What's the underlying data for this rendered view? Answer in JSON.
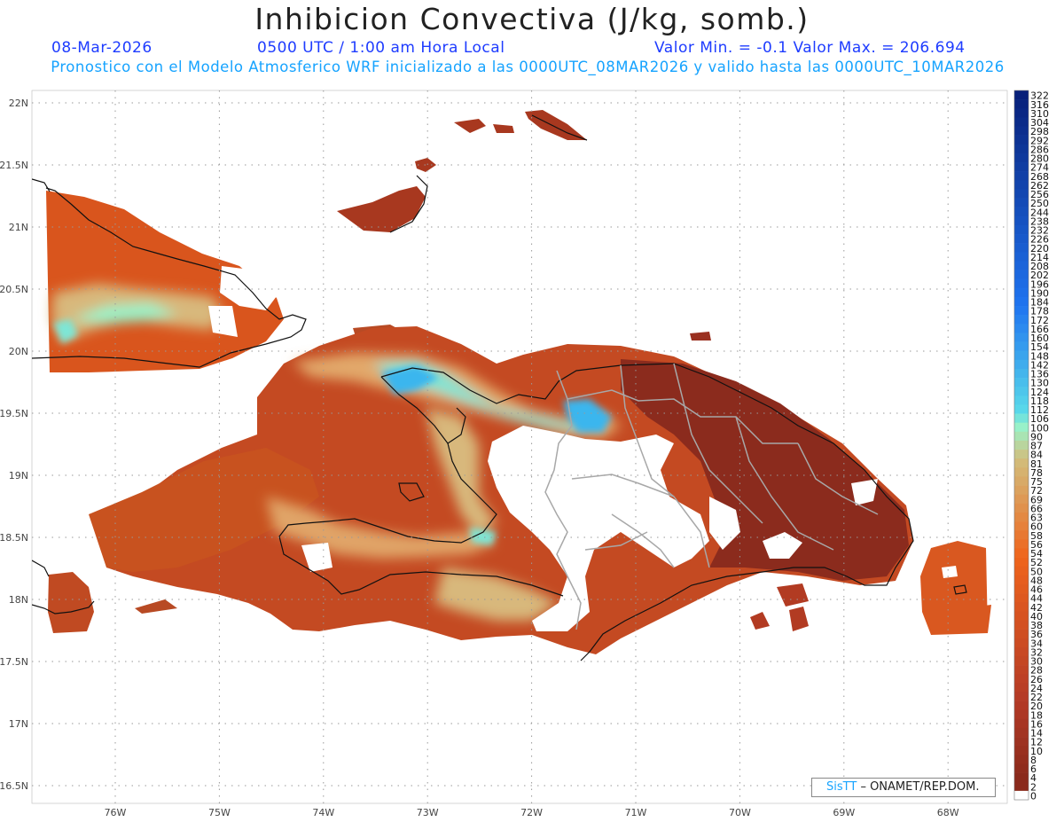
{
  "header": {
    "title": "Inhibicion Convectiva (J/kg, somb.)",
    "date": "08-Mar-2026",
    "utc_local": "0500 UTC / 1:00 am Hora Local",
    "min_max": "Valor Min. = -0.1  Valor Max. = 206.694",
    "model_line": "Pronostico con el Modelo Atmosferico WRF inicializado a las 0000UTC_08MAR2026 y valido hasta las  0000UTC_10MAR2026"
  },
  "axes": {
    "lat_labels": [
      "22N",
      "21.5N",
      "21N",
      "20.5N",
      "20N",
      "19.5N",
      "19N",
      "18.5N",
      "18N",
      "17.5N",
      "17N",
      "16.5N"
    ],
    "lon_labels": [
      "76W",
      "75W",
      "74W",
      "73W",
      "72W",
      "71W",
      "70W",
      "69W",
      "68W"
    ],
    "lat_values": [
      22,
      21.5,
      21,
      20.5,
      20,
      19.5,
      19,
      18.5,
      18,
      17.5,
      17,
      16.5
    ],
    "lon_values": [
      -76,
      -75,
      -74,
      -73,
      -72,
      -71,
      -70,
      -69,
      -68
    ]
  },
  "colorbar": {
    "labels": [
      "322",
      "316",
      "310",
      "304",
      "298",
      "292",
      "286",
      "280",
      "274",
      "268",
      "262",
      "256",
      "250",
      "244",
      "238",
      "232",
      "226",
      "220",
      "214",
      "208",
      "202",
      "196",
      "190",
      "184",
      "178",
      "172",
      "166",
      "160",
      "154",
      "148",
      "142",
      "136",
      "130",
      "124",
      "118",
      "112",
      "106",
      "100",
      "90",
      "87",
      "84",
      "81",
      "78",
      "75",
      "72",
      "69",
      "66",
      "63",
      "60",
      "58",
      "56",
      "54",
      "52",
      "50",
      "48",
      "46",
      "44",
      "42",
      "40",
      "38",
      "36",
      "34",
      "32",
      "30",
      "28",
      "26",
      "24",
      "22",
      "20",
      "18",
      "16",
      "14",
      "12",
      "10",
      "8",
      "6",
      "4",
      "2",
      "0"
    ],
    "colors": {
      "high": "#08207a",
      "blue": "#1f74f0",
      "cyan": "#58d8ea",
      "mint": "#9af2c8",
      "tan": "#d2be7c",
      "orange": "#ef641c",
      "red": "#b53b26",
      "maroon": "#8a2a1c",
      "zero": "#ffffff"
    }
  },
  "credit": {
    "brand": "SisTT",
    "org": "– ONAMET/REP.DOM."
  }
}
